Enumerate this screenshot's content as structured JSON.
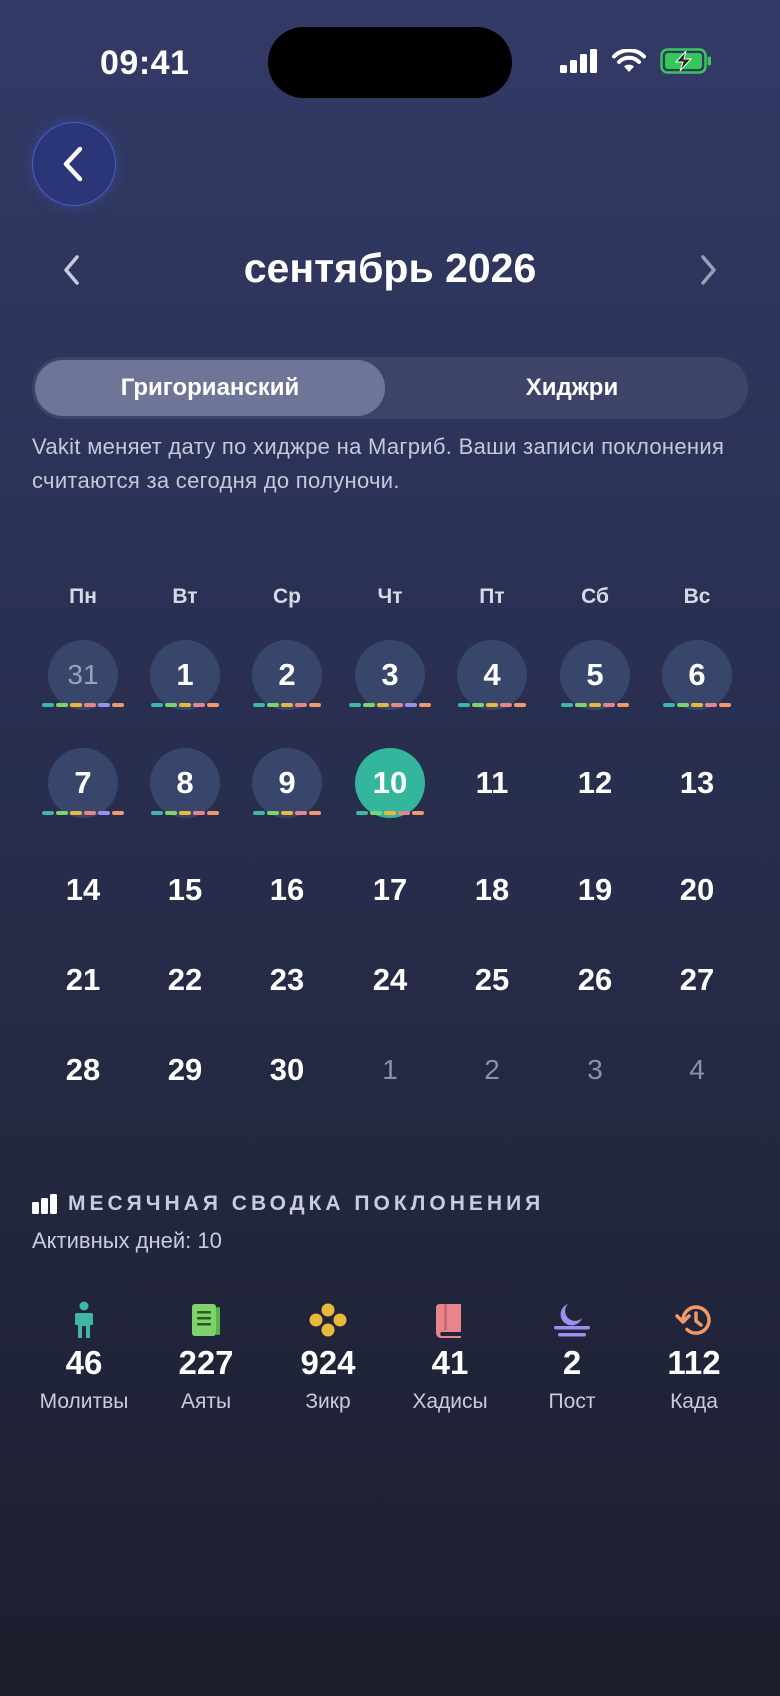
{
  "status_bar": {
    "time": "09:41"
  },
  "header": {
    "month_title": "сентябрь 2026"
  },
  "tabs": [
    {
      "label": "Григорианский",
      "active": true
    },
    {
      "label": "Хиджри",
      "active": false
    }
  ],
  "info_text": "Vakit меняет дату по хиджре на Магриб. Ваши записи поклонения считаются за сегодня до полуночи.",
  "colors": {
    "today": "#33b69c",
    "logged_day": "#37466a",
    "prayer": "#3fb7a6",
    "ayat": "#7fd36a",
    "dhikr": "#e9b93b",
    "hadith": "#e8848c",
    "fast": "#9e8ef0",
    "qada": "#f09a6a"
  },
  "calendar": {
    "weekdays": [
      "Пн",
      "Вт",
      "Ср",
      "Чт",
      "Пт",
      "Сб",
      "Вс"
    ],
    "weeks": [
      [
        {
          "d": "31",
          "type": "prev",
          "logged": true,
          "marks": [
            "prayer",
            "ayat",
            "dhikr",
            "hadith",
            "fast",
            "qada"
          ]
        },
        {
          "d": "1",
          "type": "cur",
          "logged": true,
          "marks": [
            "prayer",
            "ayat",
            "dhikr",
            "hadith",
            "qada"
          ]
        },
        {
          "d": "2",
          "type": "cur",
          "logged": true,
          "marks": [
            "prayer",
            "ayat",
            "dhikr",
            "hadith",
            "qada"
          ]
        },
        {
          "d": "3",
          "type": "cur",
          "logged": true,
          "marks": [
            "prayer",
            "ayat",
            "dhikr",
            "hadith",
            "fast",
            "qada"
          ]
        },
        {
          "d": "4",
          "type": "cur",
          "logged": true,
          "marks": [
            "prayer",
            "ayat",
            "dhikr",
            "hadith",
            "qada"
          ]
        },
        {
          "d": "5",
          "type": "cur",
          "logged": true,
          "marks": [
            "prayer",
            "ayat",
            "dhikr",
            "hadith",
            "qada"
          ]
        },
        {
          "d": "6",
          "type": "cur",
          "logged": true,
          "marks": [
            "prayer",
            "ayat",
            "dhikr",
            "hadith",
            "qada"
          ]
        }
      ],
      [
        {
          "d": "7",
          "type": "cur",
          "logged": true,
          "marks": [
            "prayer",
            "ayat",
            "dhikr",
            "hadith",
            "fast",
            "qada"
          ]
        },
        {
          "d": "8",
          "type": "cur",
          "logged": true,
          "marks": [
            "prayer",
            "ayat",
            "dhikr",
            "hadith",
            "qada"
          ]
        },
        {
          "d": "9",
          "type": "cur",
          "logged": true,
          "marks": [
            "prayer",
            "ayat",
            "dhikr",
            "hadith",
            "qada"
          ]
        },
        {
          "d": "10",
          "type": "today",
          "logged": true,
          "marks": [
            "prayer",
            "ayat",
            "dhikr",
            "hadith",
            "qada"
          ]
        },
        {
          "d": "11",
          "type": "cur"
        },
        {
          "d": "12",
          "type": "cur"
        },
        {
          "d": "13",
          "type": "cur"
        }
      ],
      [
        {
          "d": "14",
          "type": "cur"
        },
        {
          "d": "15",
          "type": "cur"
        },
        {
          "d": "16",
          "type": "cur"
        },
        {
          "d": "17",
          "type": "cur"
        },
        {
          "d": "18",
          "type": "cur"
        },
        {
          "d": "19",
          "type": "cur"
        },
        {
          "d": "20",
          "type": "cur"
        }
      ],
      [
        {
          "d": "21",
          "type": "cur"
        },
        {
          "d": "22",
          "type": "cur"
        },
        {
          "d": "23",
          "type": "cur"
        },
        {
          "d": "24",
          "type": "cur"
        },
        {
          "d": "25",
          "type": "cur"
        },
        {
          "d": "26",
          "type": "cur"
        },
        {
          "d": "27",
          "type": "cur"
        }
      ],
      [
        {
          "d": "28",
          "type": "cur"
        },
        {
          "d": "29",
          "type": "cur"
        },
        {
          "d": "30",
          "type": "cur"
        },
        {
          "d": "1",
          "type": "next"
        },
        {
          "d": "2",
          "type": "next"
        },
        {
          "d": "3",
          "type": "next"
        },
        {
          "d": "4",
          "type": "next"
        }
      ]
    ]
  },
  "summary": {
    "title": "МЕСЯЧНАЯ СВОДКА ПОКЛОНЕНИЯ",
    "active_days": "Активных дней: 10",
    "stats": [
      {
        "icon": "person-icon",
        "value": "46",
        "label": "Молитвы"
      },
      {
        "icon": "book-icon",
        "value": "227",
        "label": "Аяты"
      },
      {
        "icon": "beads-icon",
        "value": "924",
        "label": "Зикр"
      },
      {
        "icon": "hadith-book-icon",
        "value": "41",
        "label": "Хадисы"
      },
      {
        "icon": "moon-icon",
        "value": "2",
        "label": "Пост"
      },
      {
        "icon": "history-icon",
        "value": "112",
        "label": "Када"
      }
    ]
  }
}
